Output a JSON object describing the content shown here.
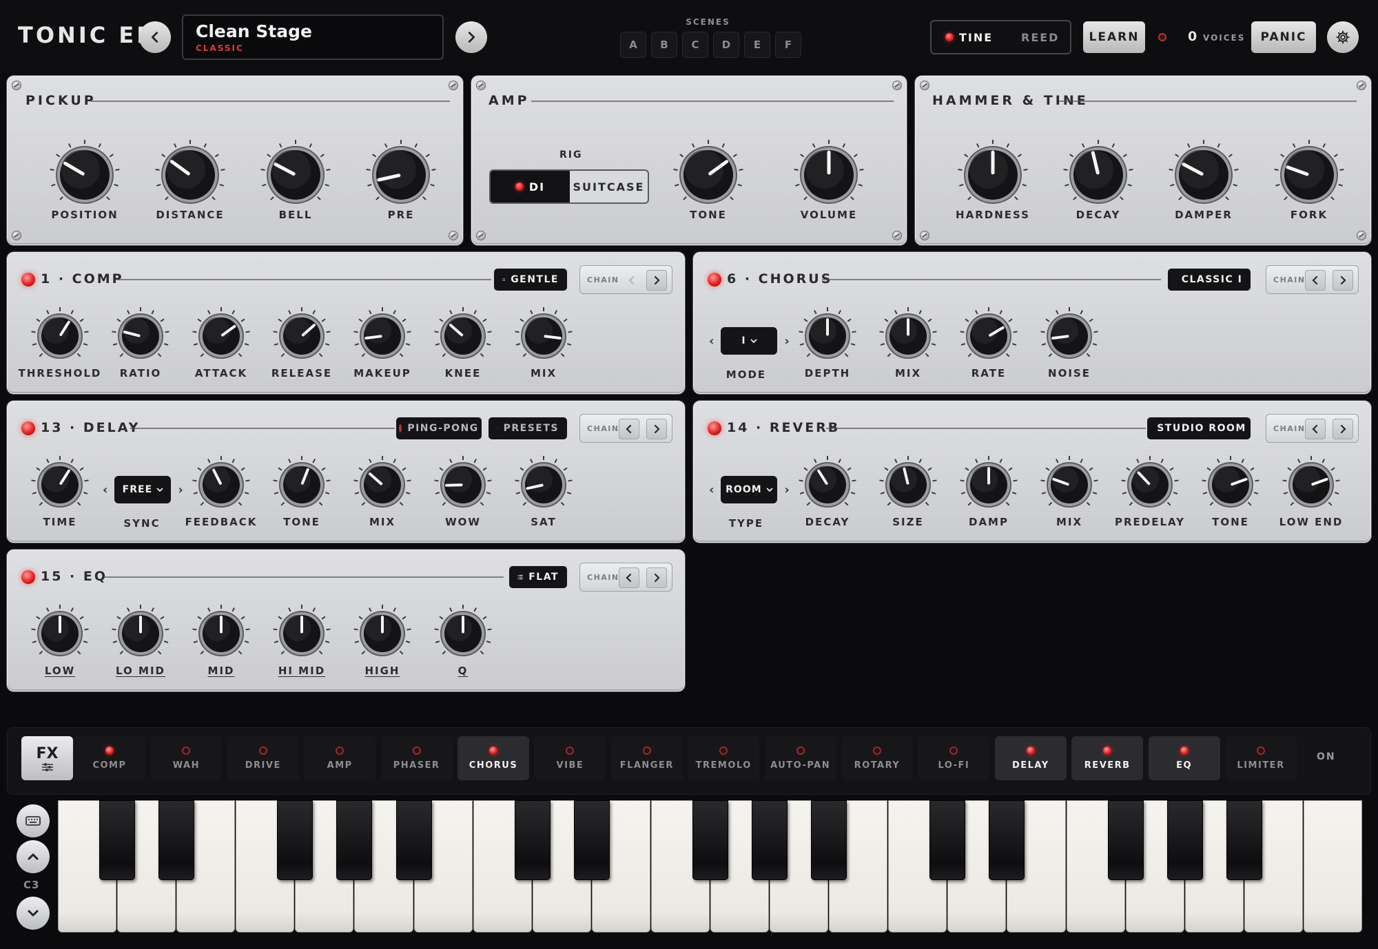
{
  "app": {
    "title": "TONIC EP"
  },
  "preset": {
    "name": "Clean Stage",
    "category": "CLASSIC"
  },
  "scenes": {
    "label": "SCENES",
    "items": [
      "A",
      "B",
      "C",
      "D",
      "E",
      "F"
    ]
  },
  "engine": {
    "active": "TINE",
    "inactive": "REED"
  },
  "toolbar": {
    "learn": "LEARN",
    "voices_count": "0",
    "voices_label": "VOICES",
    "panic": "PANIC"
  },
  "pickup": {
    "title": "PICKUP",
    "knobs": [
      {
        "label": "POSITION",
        "value": 0.28
      },
      {
        "label": "DISTANCE",
        "value": 0.3
      },
      {
        "label": "BELL",
        "value": 0.27
      },
      {
        "label": "PRE",
        "value": 0.12
      }
    ]
  },
  "amp": {
    "title": "AMP",
    "rig_label": "RIG",
    "rig_on": "DI",
    "rig_off": "SUITCASE",
    "knobs": [
      {
        "label": "TONE",
        "value": 0.7
      },
      {
        "label": "VOLUME",
        "value": 0.5
      }
    ]
  },
  "hammer": {
    "title": "HAMMER & TINE",
    "knobs": [
      {
        "label": "HARDNESS",
        "value": 0.5
      },
      {
        "label": "DECAY",
        "value": 0.45
      },
      {
        "label": "DAMPER",
        "value": 0.27
      },
      {
        "label": "FORK",
        "value": 0.24
      }
    ]
  },
  "comp": {
    "title": "1 · COMP",
    "preset": "GENTLE",
    "chain": "CHAIN",
    "knobs": [
      {
        "label": "THRESHOLD",
        "value": 0.62
      },
      {
        "label": "RATIO",
        "value": 0.22
      },
      {
        "label": "ATTACK",
        "value": 0.7
      },
      {
        "label": "RELEASE",
        "value": 0.68
      },
      {
        "label": "MAKEUP",
        "value": 0.14
      },
      {
        "label": "KNEE",
        "value": 0.32
      },
      {
        "label": "MIX",
        "value": 0.86
      }
    ]
  },
  "chorus": {
    "title": "6 · CHORUS",
    "preset": "CLASSIC I",
    "chain": "CHAIN",
    "mode_value": "I",
    "mode_label": "MODE",
    "knobs": [
      {
        "label": "DEPTH",
        "value": 0.5
      },
      {
        "label": "MIX",
        "value": 0.5
      },
      {
        "label": "RATE",
        "value": 0.72
      },
      {
        "label": "NOISE",
        "value": 0.14
      }
    ]
  },
  "delay": {
    "title": "13 · DELAY",
    "toggle": "PING-PONG",
    "presets": "PRESETS",
    "chain": "CHAIN",
    "sync_value": "FREE",
    "sync_label": "SYNC",
    "knobs_before": [
      {
        "label": "TIME",
        "value": 0.62
      }
    ],
    "knobs_after": [
      {
        "label": "FEEDBACK",
        "value": 0.4
      },
      {
        "label": "TONE",
        "value": 0.58
      },
      {
        "label": "MIX",
        "value": 0.32
      },
      {
        "label": "WOW",
        "value": 0.16
      },
      {
        "label": "SAT",
        "value": 0.12
      }
    ]
  },
  "reverb": {
    "title": "14 · REVERB",
    "preset": "STUDIO ROOM",
    "chain": "CHAIN",
    "type_value": "ROOM",
    "type_label": "TYPE",
    "knobs": [
      {
        "label": "DECAY",
        "value": 0.38
      },
      {
        "label": "SIZE",
        "value": 0.45
      },
      {
        "label": "DAMP",
        "value": 0.5
      },
      {
        "label": "MIX",
        "value": 0.24
      },
      {
        "label": "PREDELAY",
        "value": 0.34
      },
      {
        "label": "TONE",
        "value": 0.76
      },
      {
        "label": "LOW END",
        "value": 0.76
      }
    ]
  },
  "eq": {
    "title": "15 · EQ",
    "preset": "FLAT",
    "chain": "CHAIN",
    "knobs": [
      {
        "label": "LOW",
        "value": 0.5
      },
      {
        "label": "LO MID",
        "value": 0.5
      },
      {
        "label": "MID",
        "value": 0.5
      },
      {
        "label": "HI MID",
        "value": 0.5
      },
      {
        "label": "HIGH",
        "value": 0.5
      },
      {
        "label": "Q",
        "value": 0.5
      }
    ]
  },
  "fx_strip": {
    "label": "FX",
    "slots": [
      {
        "label": "COMP",
        "on": true,
        "active": false
      },
      {
        "label": "WAH",
        "on": false,
        "active": false
      },
      {
        "label": "DRIVE",
        "on": false,
        "active": false
      },
      {
        "label": "AMP",
        "on": false,
        "active": false
      },
      {
        "label": "PHASER",
        "on": false,
        "active": false
      },
      {
        "label": "CHORUS",
        "on": true,
        "active": true
      },
      {
        "label": "VIBE",
        "on": false,
        "active": false
      },
      {
        "label": "FLANGER",
        "on": false,
        "active": false
      },
      {
        "label": "TREMOLO",
        "on": false,
        "active": false
      },
      {
        "label": "AUTO-PAN",
        "on": false,
        "active": false
      },
      {
        "label": "ROTARY",
        "on": false,
        "active": false
      },
      {
        "label": "LO-FI",
        "on": false,
        "active": false
      },
      {
        "label": "DELAY",
        "on": true,
        "active": true
      },
      {
        "label": "REVERB",
        "on": true,
        "active": true
      },
      {
        "label": "EQ",
        "on": true,
        "active": true
      },
      {
        "label": "LIMITER",
        "on": false,
        "active": false
      }
    ],
    "on_label": "ON"
  },
  "keyboard": {
    "octave": "C3"
  },
  "colors": {
    "led": "#e22121",
    "panel": "#d4d5d9",
    "background": "#0b0b0d"
  }
}
